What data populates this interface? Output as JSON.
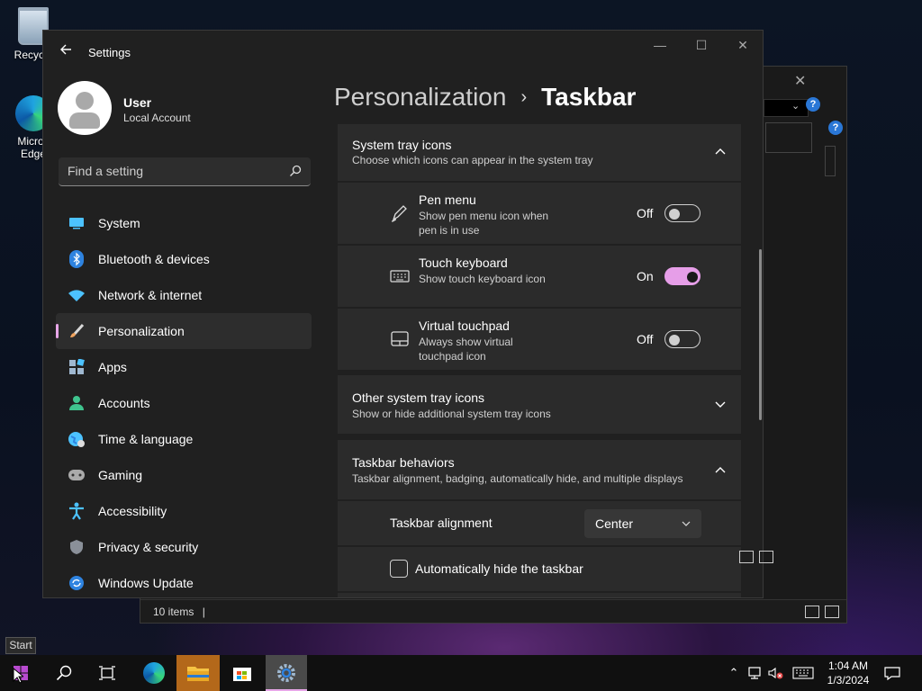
{
  "desktop": {
    "recycle_label": "Recycle",
    "edge_label_1": "Micros",
    "edge_label_2": "Edge"
  },
  "background_window": {
    "status_text": "10 items",
    "status_sep": "|"
  },
  "settings": {
    "app_title": "Settings",
    "user": {
      "name": "User",
      "account_type": "Local Account"
    },
    "search": {
      "placeholder": "Find a setting"
    },
    "nav": [
      {
        "label": "System",
        "icon": "system-icon",
        "color": "#4cc2ff"
      },
      {
        "label": "Bluetooth & devices",
        "icon": "bluetooth-icon",
        "color": "#2e83e0"
      },
      {
        "label": "Network & internet",
        "icon": "wifi-icon",
        "color": "#4cc2ff"
      },
      {
        "label": "Personalization",
        "icon": "brush-icon",
        "color": "#f0a35e",
        "active": true
      },
      {
        "label": "Apps",
        "icon": "apps-icon",
        "color": "#9fb8d0"
      },
      {
        "label": "Accounts",
        "icon": "accounts-icon",
        "color": "#3fc48e"
      },
      {
        "label": "Time & language",
        "icon": "globe-icon",
        "color": "#4cc2ff"
      },
      {
        "label": "Gaming",
        "icon": "gamepad-icon",
        "color": "#aaaaaa"
      },
      {
        "label": "Accessibility",
        "icon": "accessibility-icon",
        "color": "#4cc2ff"
      },
      {
        "label": "Privacy & security",
        "icon": "shield-icon",
        "color": "#8a9099"
      },
      {
        "label": "Windows Update",
        "icon": "update-icon",
        "color": "#2e83e0"
      }
    ],
    "breadcrumb": {
      "parent": "Personalization",
      "separator": "›",
      "current": "Taskbar"
    },
    "system_tray": {
      "title": "System tray icons",
      "subtitle": "Choose which icons can appear in the system tray",
      "items": [
        {
          "title": "Pen menu",
          "subtitle": "Show pen menu icon when pen is in use",
          "state": "Off",
          "icon": "pen-icon"
        },
        {
          "title": "Touch keyboard",
          "subtitle": "Show touch keyboard icon",
          "state": "On",
          "icon": "keyboard-icon"
        },
        {
          "title": "Virtual touchpad",
          "subtitle": "Always show virtual touchpad icon",
          "state": "Off",
          "icon": "touchpad-icon"
        }
      ]
    },
    "other_tray": {
      "title": "Other system tray icons",
      "subtitle": "Show or hide additional system tray icons"
    },
    "behaviors": {
      "title": "Taskbar behaviors",
      "subtitle": "Taskbar alignment, badging, automatically hide, and multiple displays",
      "alignment_label": "Taskbar alignment",
      "alignment_value": "Center",
      "autohide_label": "Automatically hide the taskbar"
    },
    "accent_color": "#e69ee8"
  },
  "tooltip": "Start",
  "taskbar": {
    "clock_time": "1:04 AM",
    "clock_date": "1/3/2024"
  }
}
